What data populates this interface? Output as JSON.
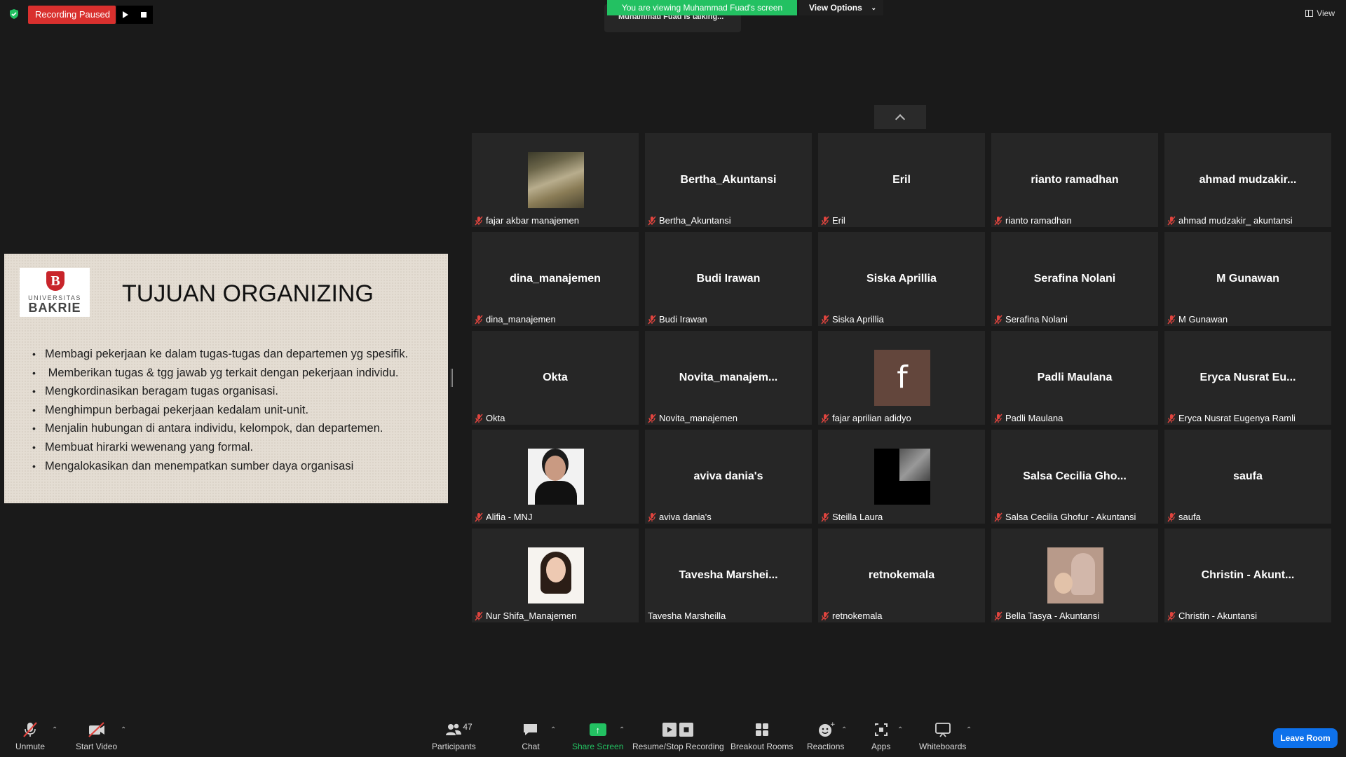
{
  "top": {
    "recording_status": "Recording Paused",
    "talking": "Muhammad Fuad is talking...",
    "viewing_banner": "You are viewing Muhammad Fuad's screen",
    "view_options": "View Options",
    "view": "View"
  },
  "slide": {
    "logo_line1": "UNIVERSITAS",
    "logo_line2": "BAKRIE",
    "logo_emblem": "B",
    "title": "TUJUAN ORGANIZING",
    "bullets": [
      "Membagi pekerjaan ke dalam tugas-tugas dan departemen yg spesifik.",
      " Memberikan tugas & tgg jawab yg terkait dengan pekerjaan individu.",
      "Mengkordinasikan beragam tugas organisasi.",
      "Menghimpun berbagai pekerjaan kedalam unit-unit.",
      "Menjalin hubungan di antara individu, kelompok, dan departemen.",
      "Membuat hirarki wewenang yang formal.",
      "Mengalokasikan dan menempatkan sumber daya organisasi"
    ]
  },
  "participants": [
    {
      "name": "",
      "label": "fajar akbar manajemen",
      "muted": true,
      "avatar": "scenery"
    },
    {
      "name": "Bertha_Akuntansi",
      "label": "Bertha_Akuntansi",
      "muted": true
    },
    {
      "name": "Eril",
      "label": "Eril",
      "muted": true
    },
    {
      "name": "rianto ramadhan",
      "label": "rianto ramadhan",
      "muted": true
    },
    {
      "name": "ahmad  mudzakir...",
      "label": "ahmad mudzakir_ akuntansi",
      "muted": true
    },
    {
      "name": "dina_manajemen",
      "label": "dina_manajemen",
      "muted": true
    },
    {
      "name": "Budi Irawan",
      "label": "Budi Irawan",
      "muted": true
    },
    {
      "name": "Siska Aprillia",
      "label": "Siska Aprillia",
      "muted": true
    },
    {
      "name": "Serafina Nolani",
      "label": "Serafina Nolani",
      "muted": true
    },
    {
      "name": "M Gunawan",
      "label": "M Gunawan",
      "muted": true
    },
    {
      "name": "Okta",
      "label": "Okta",
      "muted": true
    },
    {
      "name": "Novita_manajem...",
      "label": "Novita_manajemen",
      "muted": true
    },
    {
      "name": "",
      "label": "fajar aprilian adidyo",
      "muted": true,
      "avatar": "f",
      "avatar_text": "f"
    },
    {
      "name": "Padli Maulana",
      "label": "Padli Maulana",
      "muted": true
    },
    {
      "name": "Eryca Nusrat Eu...",
      "label": "Eryca Nusrat Eugenya Ramli",
      "muted": true
    },
    {
      "name": "",
      "label": "Alifia - MNJ",
      "muted": true,
      "avatar": "alifia"
    },
    {
      "name": "aviva dania's",
      "label": "aviva dania's",
      "muted": true
    },
    {
      "name": "",
      "label": "Steilla Laura",
      "muted": true,
      "avatar": "dark"
    },
    {
      "name": "Salsa Cecilia Gho...",
      "label": "Salsa Cecilia Ghofur - Akuntansi",
      "muted": true
    },
    {
      "name": "saufa",
      "label": "saufa",
      "muted": true
    },
    {
      "name": "",
      "label": "Nur Shifa_Manajemen",
      "muted": true,
      "avatar": "shifa"
    },
    {
      "name": "Tavesha  Marshei...",
      "label": "Tavesha Marsheilla",
      "muted": false
    },
    {
      "name": "retnokemala",
      "label": "retnokemala",
      "muted": true
    },
    {
      "name": "",
      "label": "Bella Tasya - Akuntansi",
      "muted": true,
      "avatar": "bella"
    },
    {
      "name": "Christin  - Akunt...",
      "label": "Christin  - Akuntansi",
      "muted": true
    }
  ],
  "toolbar": {
    "unmute": "Unmute",
    "start_video": "Start Video",
    "participants": "Participants",
    "participants_count": "47",
    "chat": "Chat",
    "share_screen": "Share Screen",
    "recording": "Resume/Stop Recording",
    "breakout": "Breakout Rooms",
    "reactions": "Reactions",
    "apps": "Apps",
    "whiteboards": "Whiteboards",
    "leave": "Leave Room"
  },
  "colors": {
    "accent_green": "#23c162",
    "record_red": "#d9302e",
    "leave_blue": "#0e71eb",
    "mute_red": "#e0443e"
  }
}
